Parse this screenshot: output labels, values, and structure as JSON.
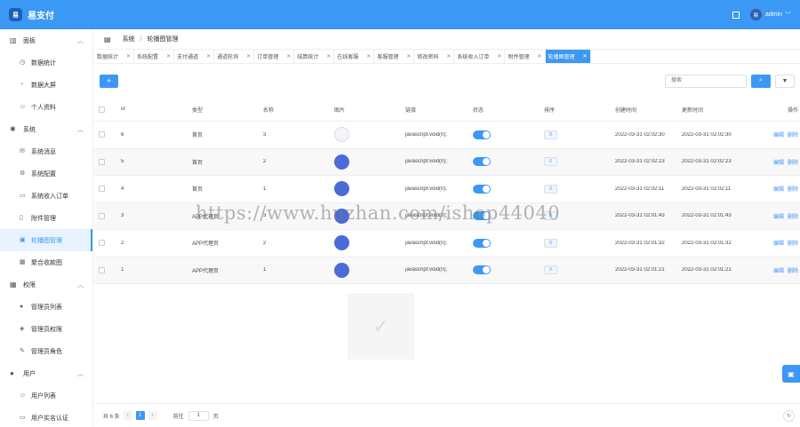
{
  "header": {
    "logo_text": "易",
    "brand": "易支付",
    "avatar_text": "易",
    "username": "admin"
  },
  "sidebar": {
    "groups": [
      {
        "label": "面板",
        "items": [
          {
            "label": "数据统计"
          },
          {
            "label": "数据大屏"
          },
          {
            "label": "个人资料"
          }
        ]
      },
      {
        "label": "系统",
        "items": [
          {
            "label": "系统消息"
          },
          {
            "label": "系统配置"
          },
          {
            "label": "系统收入订单"
          },
          {
            "label": "附件管理"
          },
          {
            "label": "轮播图管理"
          },
          {
            "label": "聚合收款图"
          }
        ]
      },
      {
        "label": "权限",
        "items": [
          {
            "label": "管理员列表"
          },
          {
            "label": "管理员权限"
          },
          {
            "label": "管理员角色"
          }
        ]
      },
      {
        "label": "用户",
        "items": [
          {
            "label": "用户列表"
          },
          {
            "label": "用户实名认证"
          }
        ]
      }
    ]
  },
  "breadcrumb": {
    "parent": "系统",
    "current": "轮播图管理"
  },
  "tabs": [
    {
      "label": "数据统计"
    },
    {
      "label": "系统配置"
    },
    {
      "label": "支付通道"
    },
    {
      "label": "通道轮询"
    },
    {
      "label": "订单管理"
    },
    {
      "label": "结算统计"
    },
    {
      "label": "在线客服"
    },
    {
      "label": "客服管理"
    },
    {
      "label": "修改密码"
    },
    {
      "label": "系统收入订单"
    },
    {
      "label": "附件管理"
    },
    {
      "label": "轮播图管理"
    }
  ],
  "toolbar": {
    "add_label": "+",
    "search_placeholder": "搜索"
  },
  "table": {
    "headers": {
      "id": "id",
      "type": "类型",
      "name": "名称",
      "image": "图片",
      "link": "链接",
      "state": "状态",
      "sort": "排序",
      "created": "创建时间",
      "updated": "更新时间",
      "ops": "操作"
    },
    "rows": [
      {
        "id": "6",
        "type": "首页",
        "name": "3",
        "link": "javascript:void(0);",
        "sort": "0",
        "created": "2022-03-31 02:02:30",
        "updated": "2022-03-31 02:02:30"
      },
      {
        "id": "5",
        "type": "首页",
        "name": "2",
        "link": "javascript:void(0);",
        "sort": "0",
        "created": "2022-03-31 02:02:23",
        "updated": "2022-03-31 02:02:23"
      },
      {
        "id": "4",
        "type": "首页",
        "name": "1",
        "link": "javascript:void(0);",
        "sort": "0",
        "created": "2022-03-31 02:02:11",
        "updated": "2022-03-31 02:02:11"
      },
      {
        "id": "3",
        "type": "APP代理页",
        "name": "3",
        "link": "javascript:void(0);",
        "sort": "0",
        "created": "2022-03-31 02:01:43",
        "updated": "2022-03-31 02:01:43"
      },
      {
        "id": "2",
        "type": "APP代理页",
        "name": "2",
        "link": "javascript:void(0);",
        "sort": "0",
        "created": "2022-03-31 02:01:32",
        "updated": "2022-03-31 02:01:32"
      },
      {
        "id": "1",
        "type": "APP代理页",
        "name": "1",
        "link": "javascript:void(0);",
        "sort": "0",
        "created": "2022-03-31 02:01:21",
        "updated": "2022-03-31 02:01:21"
      }
    ],
    "edit_label": "编辑",
    "delete_label": "删除"
  },
  "pager": {
    "total": "共 6 条",
    "current_page": "1",
    "goto_label": "前往",
    "goto_value": "1",
    "page_suffix": "页"
  },
  "watermark": "https://www.huzhan.com/ishop44040",
  "colors": {
    "primary": "#3c98f5",
    "sidebar_active_bg": "#e8f3ff"
  }
}
